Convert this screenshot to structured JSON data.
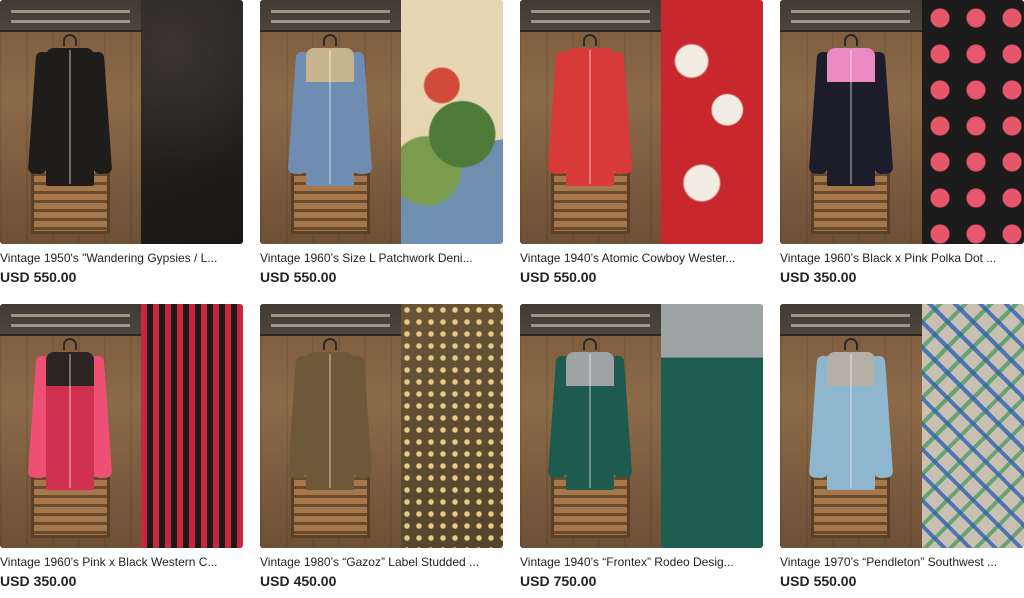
{
  "listings": [
    {
      "title": "Vintage 1950's \"Wandering Gypsies / L...",
      "currency": "USD",
      "price": "550.00",
      "shirt_color": "#1f1d1c",
      "yoke_color": "#1f1d1c",
      "sleeve_color": "#1f1d1c",
      "detail_style": "black-piping"
    },
    {
      "title": "Vintage 1960’s Size L Patchwork Deni...",
      "currency": "USD",
      "price": "550.00",
      "shirt_color": "#6f8db3",
      "yoke_color": "#c8b48c",
      "sleeve_color": "#6f8db3",
      "detail_style": "floral-patch"
    },
    {
      "title": "Vintage 1940’s Atomic Cowboy Wester...",
      "currency": "USD",
      "price": "550.00",
      "shirt_color": "#d83a3a",
      "yoke_color": "#d83a3a",
      "sleeve_color": "#d83a3a",
      "detail_style": "red-print"
    },
    {
      "title": "Vintage 1960’s Black x Pink Polka Dot ...",
      "currency": "USD",
      "price": "350.00",
      "shirt_color": "#1c1c2a",
      "yoke_color": "#e98ac2",
      "sleeve_color": "#1c1c2a",
      "detail_style": "polka"
    },
    {
      "title": "Vintage 1960’s Pink x Black Western C...",
      "currency": "USD",
      "price": "350.00",
      "shirt_color": "#d0314f",
      "yoke_color": "#2a2522",
      "sleeve_color": "#ee4f74",
      "detail_style": "stripes"
    },
    {
      "title": "Vintage 1980’s “Gazoz” Label Studded ...",
      "currency": "USD",
      "price": "450.00",
      "shirt_color": "#6e5838",
      "yoke_color": "#6e5838",
      "sleeve_color": "#6e5838",
      "detail_style": "studs"
    },
    {
      "title": "Vintage 1940’s “Frontex” Rodeo Desig...",
      "currency": "USD",
      "price": "750.00",
      "shirt_color": "#1e5a4e",
      "yoke_color": "#9ea3a3",
      "sleeve_color": "#1e5a4e",
      "detail_style": "green-back"
    },
    {
      "title": "Vintage 1970’s “Pendleton” Southwest ...",
      "currency": "USD",
      "price": "550.00",
      "shirt_color": "#8fb6cf",
      "yoke_color": "#b4b0a8",
      "sleeve_color": "#8fb6cf",
      "detail_style": "aztec"
    }
  ]
}
